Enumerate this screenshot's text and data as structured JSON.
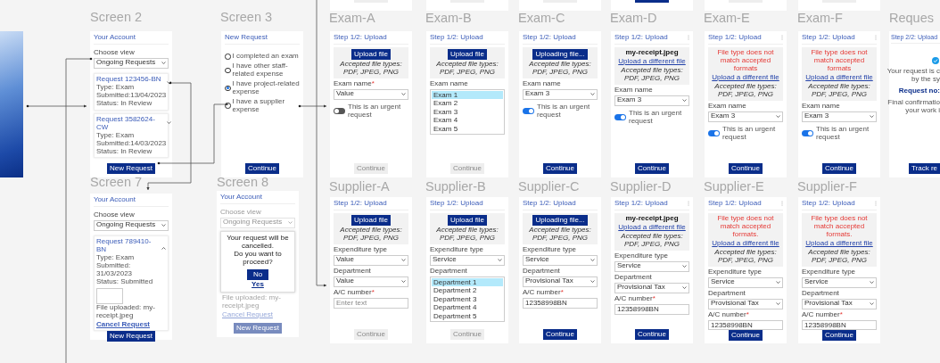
{
  "frames_above": [
    {
      "button_disabled": true
    },
    {
      "button_disabled": true
    },
    {
      "button_disabled": true
    },
    {
      "button_disabled": false
    },
    {
      "button_disabled": true
    },
    {
      "button_disabled": true
    }
  ],
  "screens": [
    {
      "kind": "account",
      "label": "Screen 2",
      "title": "Your Account",
      "view_label": "Choose view",
      "view_value": "Ongoing Requests",
      "requests": [
        {
          "title": "Request 123456-BN",
          "lines": [
            "Type: Exam",
            "Submitted:13/04/2023",
            "Status: In Review"
          ],
          "expanded": false
        },
        {
          "title": "Request 3582624-CW",
          "lines": [
            "Type: Exam",
            "Submitted:14/03/2023",
            "Status: In Review"
          ],
          "expanded": false
        }
      ],
      "button": "New Request"
    },
    {
      "kind": "choice",
      "label": "Screen 3",
      "title": "New Request",
      "options": [
        {
          "label": "I completed an exam",
          "selected": false
        },
        {
          "label": "I have other staff-related expense",
          "selected": false
        },
        {
          "label": "I have project-related expense",
          "selected": true
        },
        {
          "label": "I have a supplier expense",
          "selected": false
        }
      ],
      "button": {
        "label": "Continue",
        "disabled": false
      }
    },
    {
      "kind": "form",
      "label": "Exam-A",
      "step": "Step 1/2: Upload",
      "upload": {
        "kind": "button",
        "button": "Upload file",
        "accepted": "Accepted file types: PDF, JPEG, PNG"
      },
      "fields": [
        {
          "kind": "select",
          "label": "Exam name",
          "required_mark": "*",
          "value": "Value"
        },
        {
          "kind": "toggle",
          "label": "This is an urgent request",
          "on": false
        }
      ],
      "button": {
        "label": "Continue",
        "disabled": true
      }
    },
    {
      "kind": "form",
      "label": "Exam-B",
      "step": "Step 1/2: Upload",
      "upload": {
        "kind": "button",
        "button": "Upload file",
        "accepted": "Accepted file types: PDF, JPEG, PNG"
      },
      "fields": [
        {
          "kind": "listbox",
          "label": "Exam name",
          "options": [
            {
              "label": "Exam 1",
              "selected": true
            },
            {
              "label": "Exam 2",
              "selected": false
            },
            {
              "label": "Exam 3",
              "selected": false
            },
            {
              "label": "Exam 4",
              "selected": false
            },
            {
              "label": "Exam 5",
              "selected": false
            }
          ]
        }
      ],
      "button": {
        "label": "Continue",
        "disabled": true
      }
    },
    {
      "kind": "form",
      "label": "Exam-C",
      "step": "Step 1/2: Upload",
      "upload": {
        "kind": "button",
        "button": "Uploading file...",
        "accepted": "Accepted file types: PDF, JPEG, PNG"
      },
      "fields": [
        {
          "kind": "select",
          "label": "Exam name",
          "value": "Exam 3"
        },
        {
          "kind": "toggle",
          "label": "This is an urgent request",
          "on": true
        }
      ],
      "button": {
        "label": "Continue",
        "disabled": false
      }
    },
    {
      "kind": "form",
      "label": "Exam-D",
      "step": "Step 1/2: Upload",
      "menu": true,
      "upload": {
        "kind": "file",
        "file_name": "my-receipt.jpeg",
        "link": "Upload a different file",
        "accepted": "Accepted file types: PDF, JPEG, PNG"
      },
      "fields": [
        {
          "kind": "select",
          "label": "Exam name",
          "value": "Exam 3"
        },
        {
          "kind": "toggle",
          "label": "This is an urgent request",
          "on": true
        }
      ],
      "button": {
        "label": "Continue",
        "disabled": false
      }
    },
    {
      "kind": "form",
      "label": "Exam-E",
      "step": "Step 1/2: Upload",
      "menu": true,
      "upload": {
        "kind": "error",
        "message": "File type does not match accepted formats",
        "link": "Upload a different file",
        "accepted": "Accepted file types: PDF, JPEG, PNG"
      },
      "fields": [
        {
          "kind": "select",
          "label": "Exam name",
          "value": "Exam 3"
        },
        {
          "kind": "toggle",
          "label": "This is an urgent request",
          "on": true
        }
      ],
      "button": {
        "label": "Continue",
        "disabled": false
      }
    },
    {
      "kind": "form",
      "label": "Exam-F",
      "step": "Step 1/2: Upload",
      "menu": true,
      "upload": {
        "kind": "error",
        "message": "File type does not match accepted formats",
        "link": "Upload a different file",
        "accepted": "Accepted file types: PDF, JPEG, PNG"
      },
      "fields": [
        {
          "kind": "select",
          "label": "Exam name",
          "value": "Exam 3"
        },
        {
          "kind": "toggle",
          "label": "This is an urgent request",
          "on": true
        }
      ],
      "button": {
        "label": "Continue",
        "disabled": false
      }
    },
    {
      "kind": "confirm",
      "label": "Reques",
      "step": "Step 2/2: Upload",
      "lines": [
        "Your request is c",
        "by the sy"
      ],
      "request_no": "Request no:",
      "notes": [
        "Final confirmatio",
        "your work i"
      ],
      "button": "Track re"
    },
    {
      "kind": "account",
      "label": "Screen 7",
      "title": "Your Account",
      "view_label": "Choose view",
      "view_value": "Ongoing Requests",
      "requests": [
        {
          "title": "Request 789410-BN",
          "lines": [
            "Type: Exam",
            "Submitted: 31/03/2023",
            "Status: Submitted"
          ],
          "expanded": true,
          "file_note": "File uploaded: my-receipt.jpeg",
          "cancel": "Cancel Request"
        }
      ],
      "button": "New Request"
    },
    {
      "kind": "dialog",
      "label": "Screen 8",
      "title": "Your Account",
      "view_label": "Choose view",
      "view_value": "Ongoing Requests",
      "message": [
        "Your request will be cancelled.",
        "Do you want to proceed?"
      ],
      "confirm": "No",
      "cancel": "Yes",
      "file_note": "File uploaded: my-receipt.jpeg",
      "link": "Cancel Request",
      "button": "New Request"
    },
    {
      "kind": "form",
      "label": "Supplier-A",
      "step": "Step 1/2: Upload",
      "upload": {
        "kind": "button",
        "button": "Upload file",
        "accepted": "Accepted file types: PDF, JPEG, PNG"
      },
      "fields": [
        {
          "kind": "select",
          "label": "Expenditure type",
          "value": "Value"
        },
        {
          "kind": "select",
          "label": "Department",
          "value": "Value"
        },
        {
          "kind": "text",
          "label": "A/C number",
          "required_mark": "*",
          "placeholder": "Enter text"
        }
      ],
      "button": {
        "label": "Continue",
        "disabled": true
      }
    },
    {
      "kind": "form",
      "label": "Supplier-B",
      "step": "Step 1/2: Upload",
      "upload": {
        "kind": "button",
        "button": "Upload file",
        "accepted": "Accepted file types: PDF, JPEG, PNG"
      },
      "fields": [
        {
          "kind": "select",
          "label": "Expenditure type",
          "value": "Service"
        },
        {
          "kind": "listbox",
          "label": "Department",
          "options": [
            {
              "label": "Department 1",
              "selected": true
            },
            {
              "label": "Department 2",
              "selected": false
            },
            {
              "label": "Department 3",
              "selected": false
            },
            {
              "label": "Department 4",
              "selected": false
            },
            {
              "label": "Department 5",
              "selected": false
            }
          ]
        }
      ],
      "button": {
        "label": "Continue",
        "disabled": true
      }
    },
    {
      "kind": "form",
      "label": "Supplier-C",
      "step": "Step 1/2: Upload",
      "upload": {
        "kind": "button",
        "button": "Uploading file...",
        "accepted": "Accepted file types: PDF, JPEG, PNG"
      },
      "fields": [
        {
          "kind": "select",
          "label": "Expenditure type",
          "value": "Service"
        },
        {
          "kind": "select",
          "label": "Department",
          "value": "Provisional Tax"
        },
        {
          "kind": "text",
          "label": "A/C number",
          "required_mark": "*",
          "value": "12358998BN"
        }
      ],
      "button": {
        "label": "Continue",
        "disabled": false
      }
    },
    {
      "kind": "form",
      "label": "Supplier-D",
      "step": "Step 1/2: Upload",
      "menu": true,
      "upload": {
        "kind": "file",
        "file_name": "my-receipt.jpeg",
        "link": "Upload a different file",
        "accepted": "Accepted file types: PDF, JPEG, PNG"
      },
      "fields": [
        {
          "kind": "select",
          "label": "Expenditure type",
          "value": "Service"
        },
        {
          "kind": "select",
          "label": "Department",
          "value": "Provisional Tax"
        },
        {
          "kind": "text",
          "label": "A/C number",
          "required_mark": "*",
          "value": "12358998BN"
        }
      ],
      "button": {
        "label": "Continue",
        "disabled": false
      }
    },
    {
      "kind": "form",
      "label": "Supplier-E",
      "step": "Step 1/2: Upload",
      "menu": true,
      "upload": {
        "kind": "error",
        "message": "File type does not match accepted formats.",
        "link": "Upload a different file",
        "accepted": "Accepted file types: PDF, JPEG, PNG"
      },
      "fields": [
        {
          "kind": "select",
          "label": "Expenditure type",
          "value": "Service"
        },
        {
          "kind": "select",
          "label": "Department",
          "value": "Provisional Tax"
        },
        {
          "kind": "text",
          "label": "A/C number",
          "required_mark": "*",
          "value": "12358998BN"
        }
      ],
      "button": {
        "label": "Continue",
        "disabled": false
      }
    },
    {
      "kind": "form",
      "label": "Supplier-F",
      "step": "Step 1/2: Upload",
      "menu": true,
      "upload": {
        "kind": "error",
        "message": "File type does not match accepted formats.",
        "link": "Upload a different file",
        "accepted": "Accepted file types: PDF, JPEG, PNG"
      },
      "fields": [
        {
          "kind": "select",
          "label": "Expenditure type",
          "value": "Service"
        },
        {
          "kind": "select",
          "label": "Department",
          "value": "Provisional Tax"
        },
        {
          "kind": "text",
          "label": "A/C number",
          "required_mark": "*",
          "value": "12358998BN"
        }
      ],
      "button": {
        "label": "Continue",
        "disabled": false
      }
    }
  ]
}
